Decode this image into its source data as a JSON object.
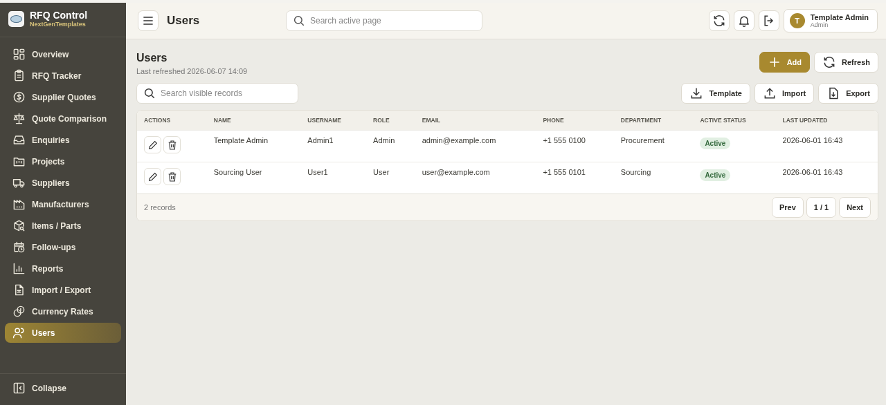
{
  "brand": {
    "title": "RFQ Control",
    "subtitle": "NextGenTemplates"
  },
  "sidebar": {
    "items": [
      {
        "label": "Overview",
        "selected": false
      },
      {
        "label": "RFQ Tracker",
        "selected": false
      },
      {
        "label": "Supplier Quotes",
        "selected": false
      },
      {
        "label": "Quote Comparison",
        "selected": false
      },
      {
        "label": "Enquiries",
        "selected": false
      },
      {
        "label": "Projects",
        "selected": false
      },
      {
        "label": "Suppliers",
        "selected": false
      },
      {
        "label": "Manufacturers",
        "selected": false
      },
      {
        "label": "Items / Parts",
        "selected": false
      },
      {
        "label": "Follow-ups",
        "selected": false
      },
      {
        "label": "Reports",
        "selected": false
      },
      {
        "label": "Import / Export",
        "selected": false
      },
      {
        "label": "Currency Rates",
        "selected": false
      },
      {
        "label": "Users",
        "selected": true
      }
    ],
    "collapse": "Collapse"
  },
  "topbar": {
    "title": "Users",
    "search": {
      "placeholder": "Search active page"
    },
    "user": {
      "initial": "T",
      "name": "Template Admin",
      "role": "Admin"
    }
  },
  "page": {
    "title": "Users",
    "subtitle": "Last refreshed 2026-06-07 14:09",
    "search": {
      "placeholder": "Search visible records"
    },
    "primary_buttons": [
      "Add",
      "Refresh"
    ],
    "tool_buttons": [
      "Template",
      "Import",
      "Export"
    ]
  },
  "table": {
    "columns": [
      "ACTIONS",
      "NAME",
      "USERNAME",
      "ROLE",
      "EMAIL",
      "PHONE",
      "DEPARTMENT",
      "ACTIVE STATUS",
      "LAST UPDATED"
    ],
    "rows": [
      {
        "name": "Template Admin",
        "username": "Admin1",
        "role": "Admin",
        "email": "admin@example.com",
        "phone": "+1 555 0100",
        "department": "Procurement",
        "status": "Active",
        "updated": "2026-06-01 16:43"
      },
      {
        "name": "Sourcing User",
        "username": "User1",
        "role": "User",
        "email": "user@example.com",
        "phone": "+1 555 0101",
        "department": "Sourcing",
        "status": "Active",
        "updated": "2026-06-01 16:43"
      }
    ],
    "footer": {
      "count": "2 records",
      "prev": "Prev",
      "page": "1 / 1",
      "next": "Next"
    }
  }
}
